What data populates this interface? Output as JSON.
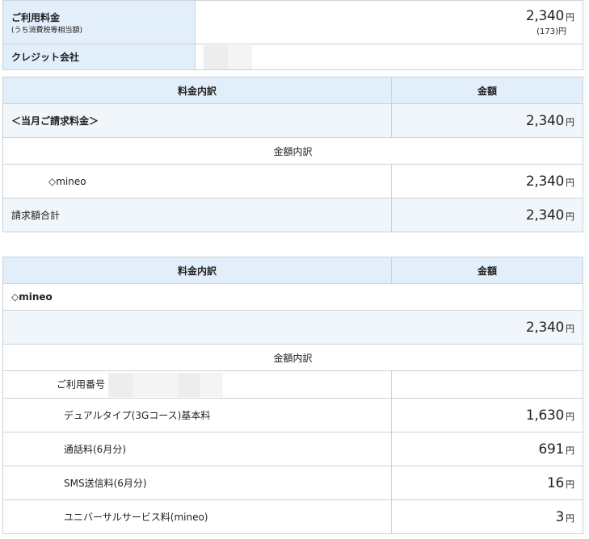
{
  "summary": {
    "fee_label": "ご利用料金",
    "tax_note": "(うち消費税等相当額)",
    "fee_value": "2,340",
    "fee_unit": "円",
    "tax_value": "(173)円",
    "card_label": "クレジット会社"
  },
  "table1": {
    "col_item": "料金内訳",
    "col_amount": "金額",
    "monthly_label": "＜当月ご請求料金＞",
    "monthly_value": "2,340",
    "breakdown_label": "金額内訳",
    "mineo_label": "◇mineo",
    "mineo_value": "2,340",
    "total_label": "請求額合計",
    "total_value": "2,340",
    "unit": "円"
  },
  "table2": {
    "col_item": "料金内訳",
    "col_amount": "金額",
    "mineo_label": "◇mineo",
    "mineo_value": "2,340",
    "breakdown_label": "金額内訳",
    "line_label": "ご利用番号",
    "unit": "円",
    "items": [
      {
        "label": "デュアルタイプ(3Gコース)基本料",
        "value": "1,630"
      },
      {
        "label": "通話料(6月分)",
        "value": "691"
      },
      {
        "label": "SMS送信料(6月分)",
        "value": "16"
      },
      {
        "label": "ユニバーサルサービス料(mineo)",
        "value": "3"
      }
    ]
  },
  "colors": {
    "header_bg": "#e3eefb",
    "row_bg": "#f1f6fb",
    "border": "#c9d2dc"
  }
}
